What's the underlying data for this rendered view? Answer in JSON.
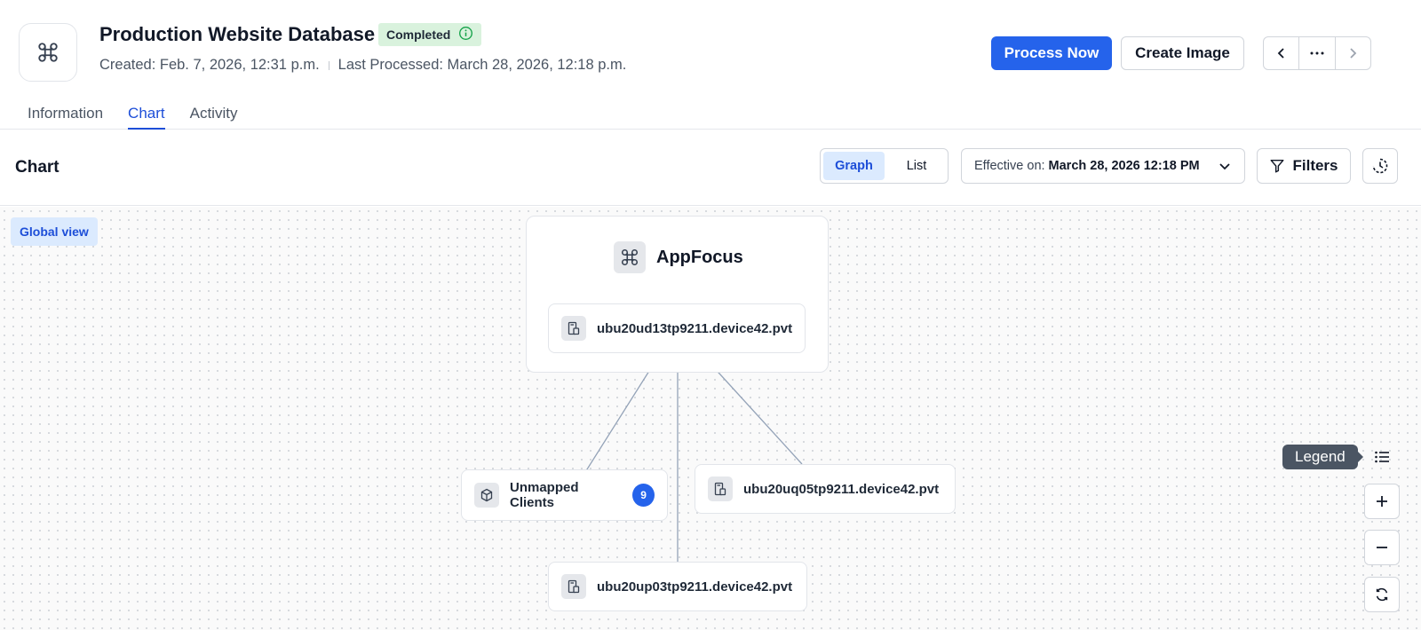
{
  "header": {
    "title": "Production Website Database",
    "status": "Completed",
    "created": "Created: Feb. 7, 2026, 12:31 p.m.",
    "last_processed": "Last Processed: March 28, 2026, 12:18 p.m.",
    "process_now_label": "Process Now",
    "create_image_label": "Create Image",
    "status_color": "#d9f2dd",
    "primary_color": "#2563eb"
  },
  "tabs": [
    {
      "label": "Information",
      "active": false
    },
    {
      "label": "Chart",
      "active": true
    },
    {
      "label": "Activity",
      "active": false
    }
  ],
  "toolbar": {
    "section_title": "Chart",
    "view_graph": "Graph",
    "view_list": "List",
    "effective_label": "Effective on:",
    "effective_value": "March 28, 2026 12:18 PM",
    "filters_label": "Filters"
  },
  "canvas": {
    "global_view_label": "Global view",
    "group": {
      "name": "AppFocus",
      "icon": "app-icon",
      "node": "ubu20ud13tp9211.device42.pvt"
    },
    "nodes": [
      {
        "name": "Unmapped Clients",
        "count": "9",
        "icon": "unknown-box-icon"
      },
      {
        "name": "ubu20uq05tp9211.device42.pvt",
        "icon": "device-icon"
      },
      {
        "name": "ubu20up03tp9211.device42.pvt",
        "icon": "device-icon"
      }
    ],
    "legend_label": "Legend"
  }
}
